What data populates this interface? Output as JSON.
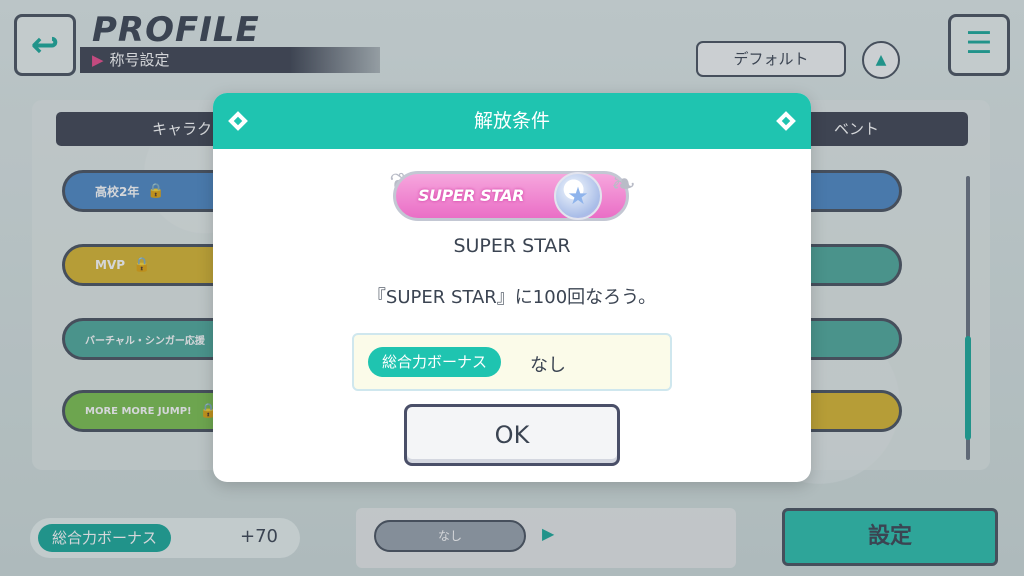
{
  "header": {
    "title": "PROFILE",
    "subtitle": "称号設定",
    "default_button": "デフォルト"
  },
  "tabs": {
    "left": "キャラク",
    "right": "ベント"
  },
  "list_items": [
    {
      "label": "高校2年",
      "color": "#4e88c4"
    },
    {
      "label": "MVP",
      "color": "#d9b630"
    },
    {
      "label": "バーチャル・シンガー応援",
      "color": "#4fa99c"
    },
    {
      "label": "MORE MORE JUMP!",
      "color": "#7cc04f"
    }
  ],
  "modal": {
    "header_title": "解放条件",
    "badge_text": "SUPER STAR",
    "title_name": "SUPER STAR",
    "condition": "『SUPER STAR』に100回なろう。",
    "bonus_label": "総合力ボーナス",
    "bonus_value": "なし",
    "ok_label": "OK"
  },
  "footer": {
    "bonus_label": "総合力ボーナス",
    "bonus_value": "+70",
    "selected_title": "なし",
    "set_label": "設定"
  },
  "colors": {
    "accent": "#1fc4b0",
    "dark": "#3f4553",
    "badge_pink": "#ea6ec6"
  },
  "icons": {
    "back": "back-arrow-icon",
    "menu": "hamburger-menu-icon",
    "sort": "sort-up-icon",
    "lock": "lock-icon",
    "star": "star-emblem-icon"
  }
}
